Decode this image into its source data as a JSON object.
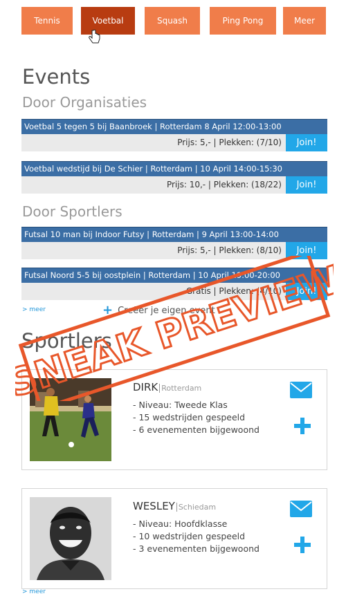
{
  "nav": {
    "tabs": [
      "Tennis",
      "Voetbal",
      "Squash",
      "Ping Pong",
      "Meer"
    ],
    "active": "Voetbal"
  },
  "events": {
    "title": "Events",
    "org_title": "Door Organisaties",
    "sportlers_title": "Door Sportlers",
    "join_label": "Join!",
    "items": [
      {
        "title": "Voetbal 5 tegen 5 bij Baanbroek | Rotterdam 8 April 12:00-13:00",
        "info": "Prijs: 5,- | Plekken: (7/10)"
      },
      {
        "title": "Voetbal wedstijd bij De Schier | Rotterdam | 10 April 14:00-15:30",
        "info": "Prijs: 10,- | Plekken: (18/22)"
      },
      {
        "title": "Futsal 10 man bij Indoor Futsy | Rotterdam | 9 April 13:00-14:00",
        "info": "Prijs: 5,- | Plekken: (8/10)"
      },
      {
        "title": "Futsal Noord 5-5 bij oostplein | Rotterdam | 10 April 19:00-20:00",
        "info": "Gratis | Plekken: (4/10)"
      }
    ],
    "more_link": "> meer",
    "create_label": "Creëer je eigen event"
  },
  "sportlers": {
    "title": "Sportlers",
    "people": [
      {
        "name": "DIRK",
        "city": "Rotterdam",
        "stats": [
          "- Niveau: Tweede Klas",
          "- 15 wedstrijden gespeeld",
          "- 6 evenementen bijgewoond"
        ]
      },
      {
        "name": "WESLEY",
        "city": "Schiedam",
        "stats": [
          "- Niveau: Hoofdklasse",
          "- 10 wedstrijden gespeeld",
          "- 3 evenementen bijgewoond"
        ]
      }
    ],
    "more_link": "> meer"
  },
  "stamp": {
    "text": "SNEAK PREVIEW"
  },
  "colors": {
    "tab": "#f07d4a",
    "tab_active": "#b83c11",
    "event_bar": "#3b6ea5",
    "join": "#22a7e8",
    "stamp": "#e8572a"
  }
}
